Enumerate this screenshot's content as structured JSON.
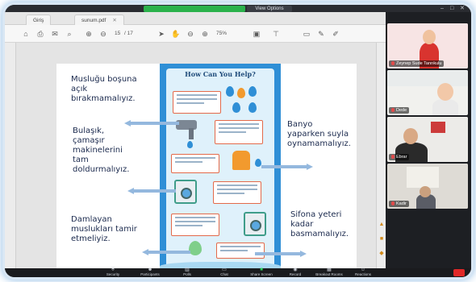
{
  "meeting": {
    "share_status": "",
    "view_options_label": "View Options",
    "window_controls": [
      "–",
      "□",
      "✕"
    ]
  },
  "pdf": {
    "tabs": [
      {
        "label": "Giriş"
      },
      {
        "label": "sunum.pdf"
      }
    ],
    "page_current": "15",
    "page_total": "/ 17",
    "zoom": "75%",
    "toolbar_icons": [
      "home-icon",
      "print-icon",
      "email-icon",
      "search-icon",
      "prev-page-icon",
      "next-page-icon",
      "select-icon",
      "hand-icon",
      "zoom-out-icon",
      "zoom-in-icon",
      "fit-page-icon",
      "comment-icon",
      "pen-icon",
      "sign-icon"
    ]
  },
  "slide": {
    "poster_title": "How Can You Help?",
    "notes": {
      "tap": "Musluğu boşuna\naçık\nbırakmamalıyız.",
      "dishwasher": "Bulaşık,\nçamaşır\nmakinelerini\ntam\ndoldurmalıyız.",
      "leak": "Damlayan\nmuslukları tamir\netmeliyiz.",
      "bath": "Banyo\nyaparken suyla\noynamamalıyız.",
      "flush": "Sifona yeteri\nkadar\nbasmamalıyız."
    }
  },
  "participants": [
    {
      "name": "Zeynep Sude Tanrıkulu"
    },
    {
      "name": "Dede"
    },
    {
      "name": "Ebrar"
    },
    {
      "name": "Kadir"
    }
  ],
  "controls": [
    {
      "label": "Security",
      "icon": "shield-icon"
    },
    {
      "label": "Participants",
      "icon": "participants-icon"
    },
    {
      "label": "Polls",
      "icon": "polls-icon"
    },
    {
      "label": "Chat",
      "icon": "chat-icon"
    },
    {
      "label": "Share Screen",
      "icon": "share-screen-icon"
    },
    {
      "label": "Record",
      "icon": "record-icon"
    },
    {
      "label": "Breakout Rooms",
      "icon": "breakout-icon"
    },
    {
      "label": "Reactions",
      "icon": "reactions-icon"
    }
  ],
  "colors": {
    "accent_green": "#2bb24c",
    "poster_blue": "#2f8fd6",
    "end_red": "#e02828"
  }
}
